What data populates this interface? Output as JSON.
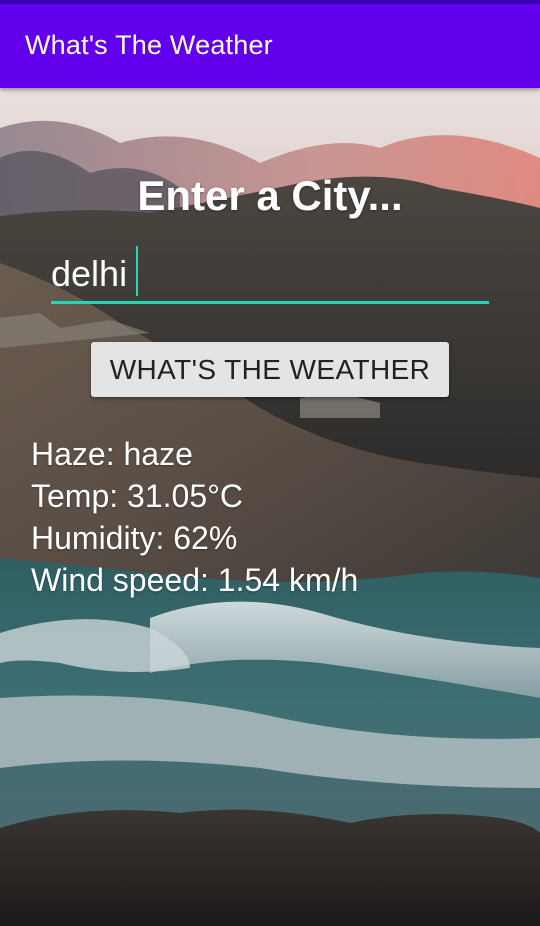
{
  "app_bar": {
    "title": "What's The Weather",
    "color": "#6200ee"
  },
  "form": {
    "heading": "Enter a City...",
    "city_value": "delhi",
    "underline_color": "#2ad4b6",
    "button_label": "WHAT'S THE WEATHER"
  },
  "result": {
    "lines": [
      "Haze: haze",
      "Temp: 31.05°C",
      "Humidity: 62%",
      "Wind speed: 1.54 km/h"
    ]
  }
}
